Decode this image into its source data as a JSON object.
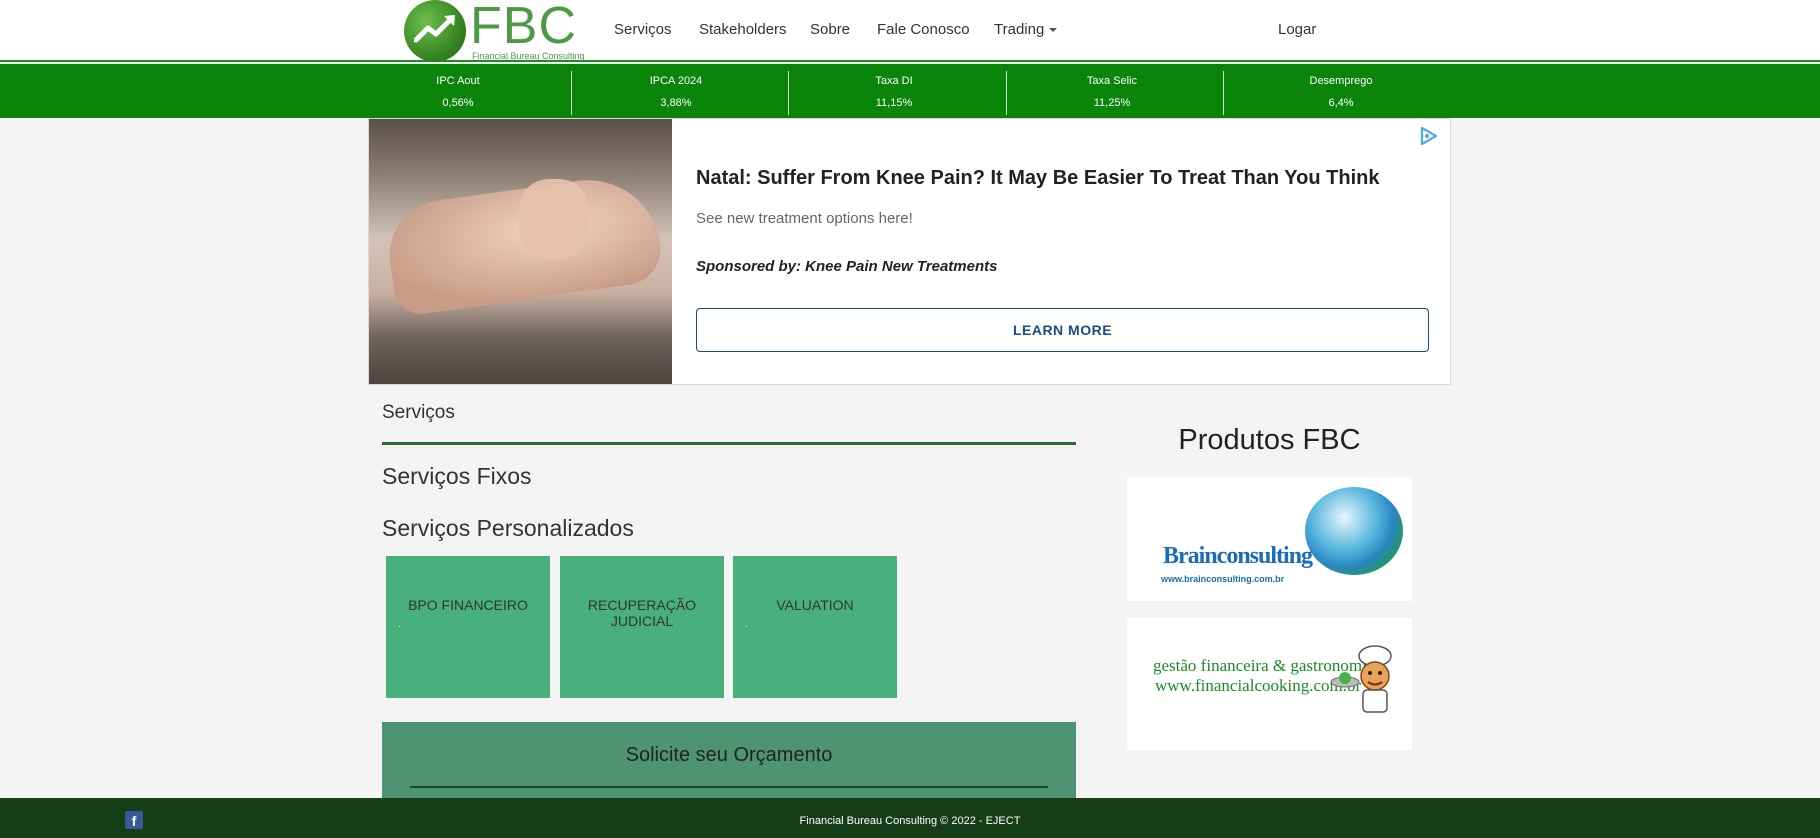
{
  "brand": {
    "name": "FBC",
    "tagline": "Financial Bureau Consulting"
  },
  "nav": {
    "items": [
      "Serviços",
      "Stakeholders",
      "Sobre",
      "Fale Conosco",
      "Trading"
    ],
    "login": "Logar"
  },
  "ticker": [
    {
      "label": "IPC Aout",
      "value": "0,56%"
    },
    {
      "label": "IPCA 2024",
      "value": "3,88%"
    },
    {
      "label": "Taxa DI",
      "value": "11,15%"
    },
    {
      "label": "Taxa Selic",
      "value": "11,25%"
    },
    {
      "label": "Desemprego",
      "value": "6,4%"
    }
  ],
  "ad": {
    "title": "Natal: Suffer From Knee Pain? It May Be Easier To Treat Than You Think",
    "description": "See new treatment options here!",
    "sponsor": "Sponsored by: Knee Pain New Treatments",
    "button": "LEARN MORE",
    "icon": "adchoices-icon"
  },
  "main": {
    "section_title": "Serviços",
    "fixed_title": "Serviços Fixos",
    "custom_title": "Serviços Personalizados",
    "cards": [
      "BPO FINANCEIRO",
      "RECUPERAÇÃO JUDICIAL",
      "VALUATION"
    ],
    "quote_title": "Solicite seu Orçamento"
  },
  "sidebar": {
    "title": "Produtos FBC",
    "brain": {
      "name": "Brainconsulting",
      "url": "www.brainconsulting.com.br"
    },
    "cooking": {
      "line1": "gestão financeira & gastronomia",
      "line2": "www.financialcooking.com.br"
    }
  },
  "footer": {
    "copyright": "Financial Bureau Consulting © 2022 - EJECT",
    "facebook_icon": "facebook-icon"
  },
  "colors": {
    "ticker_bg": "#0a850a",
    "footer_bg": "#163e16",
    "card_bg": "#47b07b",
    "quote_bg": "#4e9474",
    "ad_button": "#1a4c8c"
  }
}
